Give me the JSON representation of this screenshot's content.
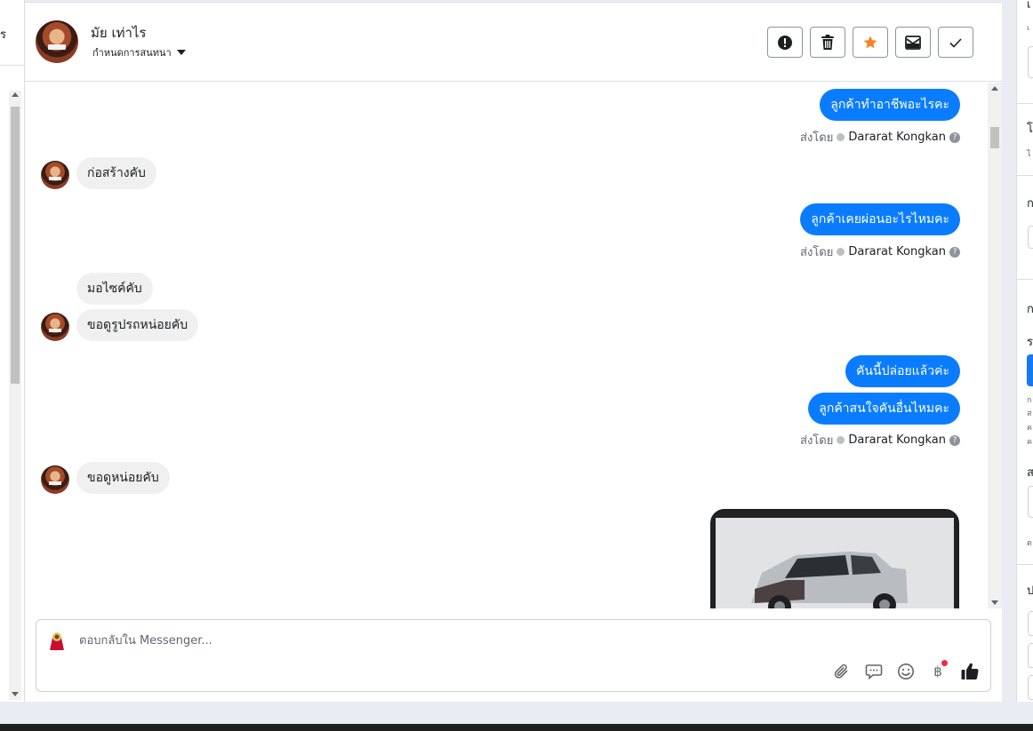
{
  "left_panel": {
    "cut_char": "ร"
  },
  "header": {
    "contact_name": "มัย เท่าไร",
    "assign_label": "กำหนดการสนทนา",
    "actions": [
      {
        "name": "spam-button",
        "icon": "alert-icon"
      },
      {
        "name": "delete-button",
        "icon": "trash-icon"
      },
      {
        "name": "star-button",
        "icon": "star-icon"
      },
      {
        "name": "mark-unread-button",
        "icon": "envelope-icon"
      },
      {
        "name": "done-button",
        "icon": "check-icon"
      }
    ]
  },
  "messages": [
    {
      "dir": "out",
      "text": "ลูกค้าทำอาชีพอะไรคะ"
    },
    {
      "dir": "meta",
      "prefix": "ส่งโดย",
      "sender": "Dararat Kongkan"
    },
    {
      "dir": "in",
      "text": "ก่อสร้างคับ"
    },
    {
      "dir": "out",
      "text": "ลูกค้าเคยผ่อนอะไรไหมคะ"
    },
    {
      "dir": "meta",
      "prefix": "ส่งโดย",
      "sender": "Dararat Kongkan"
    },
    {
      "dir": "in",
      "text": "มอไซค์คับ"
    },
    {
      "dir": "in",
      "text": "ขอดูรูปรถหน่อยคับ"
    },
    {
      "dir": "out",
      "text": "คันนี้ปล่อยแล้วค่ะ"
    },
    {
      "dir": "out",
      "text": "ลูกค้าสนใจคันอื่นไหมคะ"
    },
    {
      "dir": "meta",
      "prefix": "ส่งโดย",
      "sender": "Dararat Kongkan"
    },
    {
      "dir": "in",
      "text": "ขอดูหน่อยคับ"
    }
  ],
  "composer": {
    "placeholder": "ตอบกลับใน Messenger...",
    "baht_symbol": "฿"
  },
  "right_panel": {
    "chars": [
      "เ",
      "โ",
      "ไ",
      "ก",
      "ก",
      "ร",
      "ก",
      "ส",
      "ค",
      "ค",
      "ส",
      "ต",
      "ป"
    ]
  },
  "colors": {
    "outgoing_bubble": "#0a7cff",
    "incoming_bubble": "#f0f0f0",
    "star": "#f5831f",
    "notification_dot": "#f02849"
  }
}
